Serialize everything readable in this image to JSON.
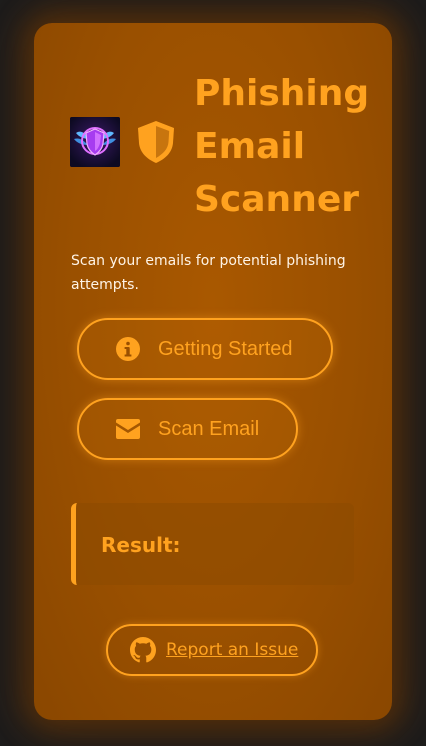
{
  "header": {
    "title": "Phishing\nEmail\nScanner",
    "logo_icon": "shield-wings-logo",
    "shield_icon": "shield-icon"
  },
  "description": "Scan your emails for potential phishing attempts.",
  "buttons": {
    "getting_started": {
      "label": "Getting Started",
      "icon": "info-icon"
    },
    "scan_email": {
      "label": "Scan Email",
      "icon": "envelope-icon"
    }
  },
  "result": {
    "label": "Result:"
  },
  "footer": {
    "report_label": "Report an Issue",
    "icon": "github-icon"
  },
  "colors": {
    "accent": "#ffa21f",
    "panel": "#9a5000",
    "background": "#1c1c1c",
    "text_light": "#fff4e6"
  }
}
